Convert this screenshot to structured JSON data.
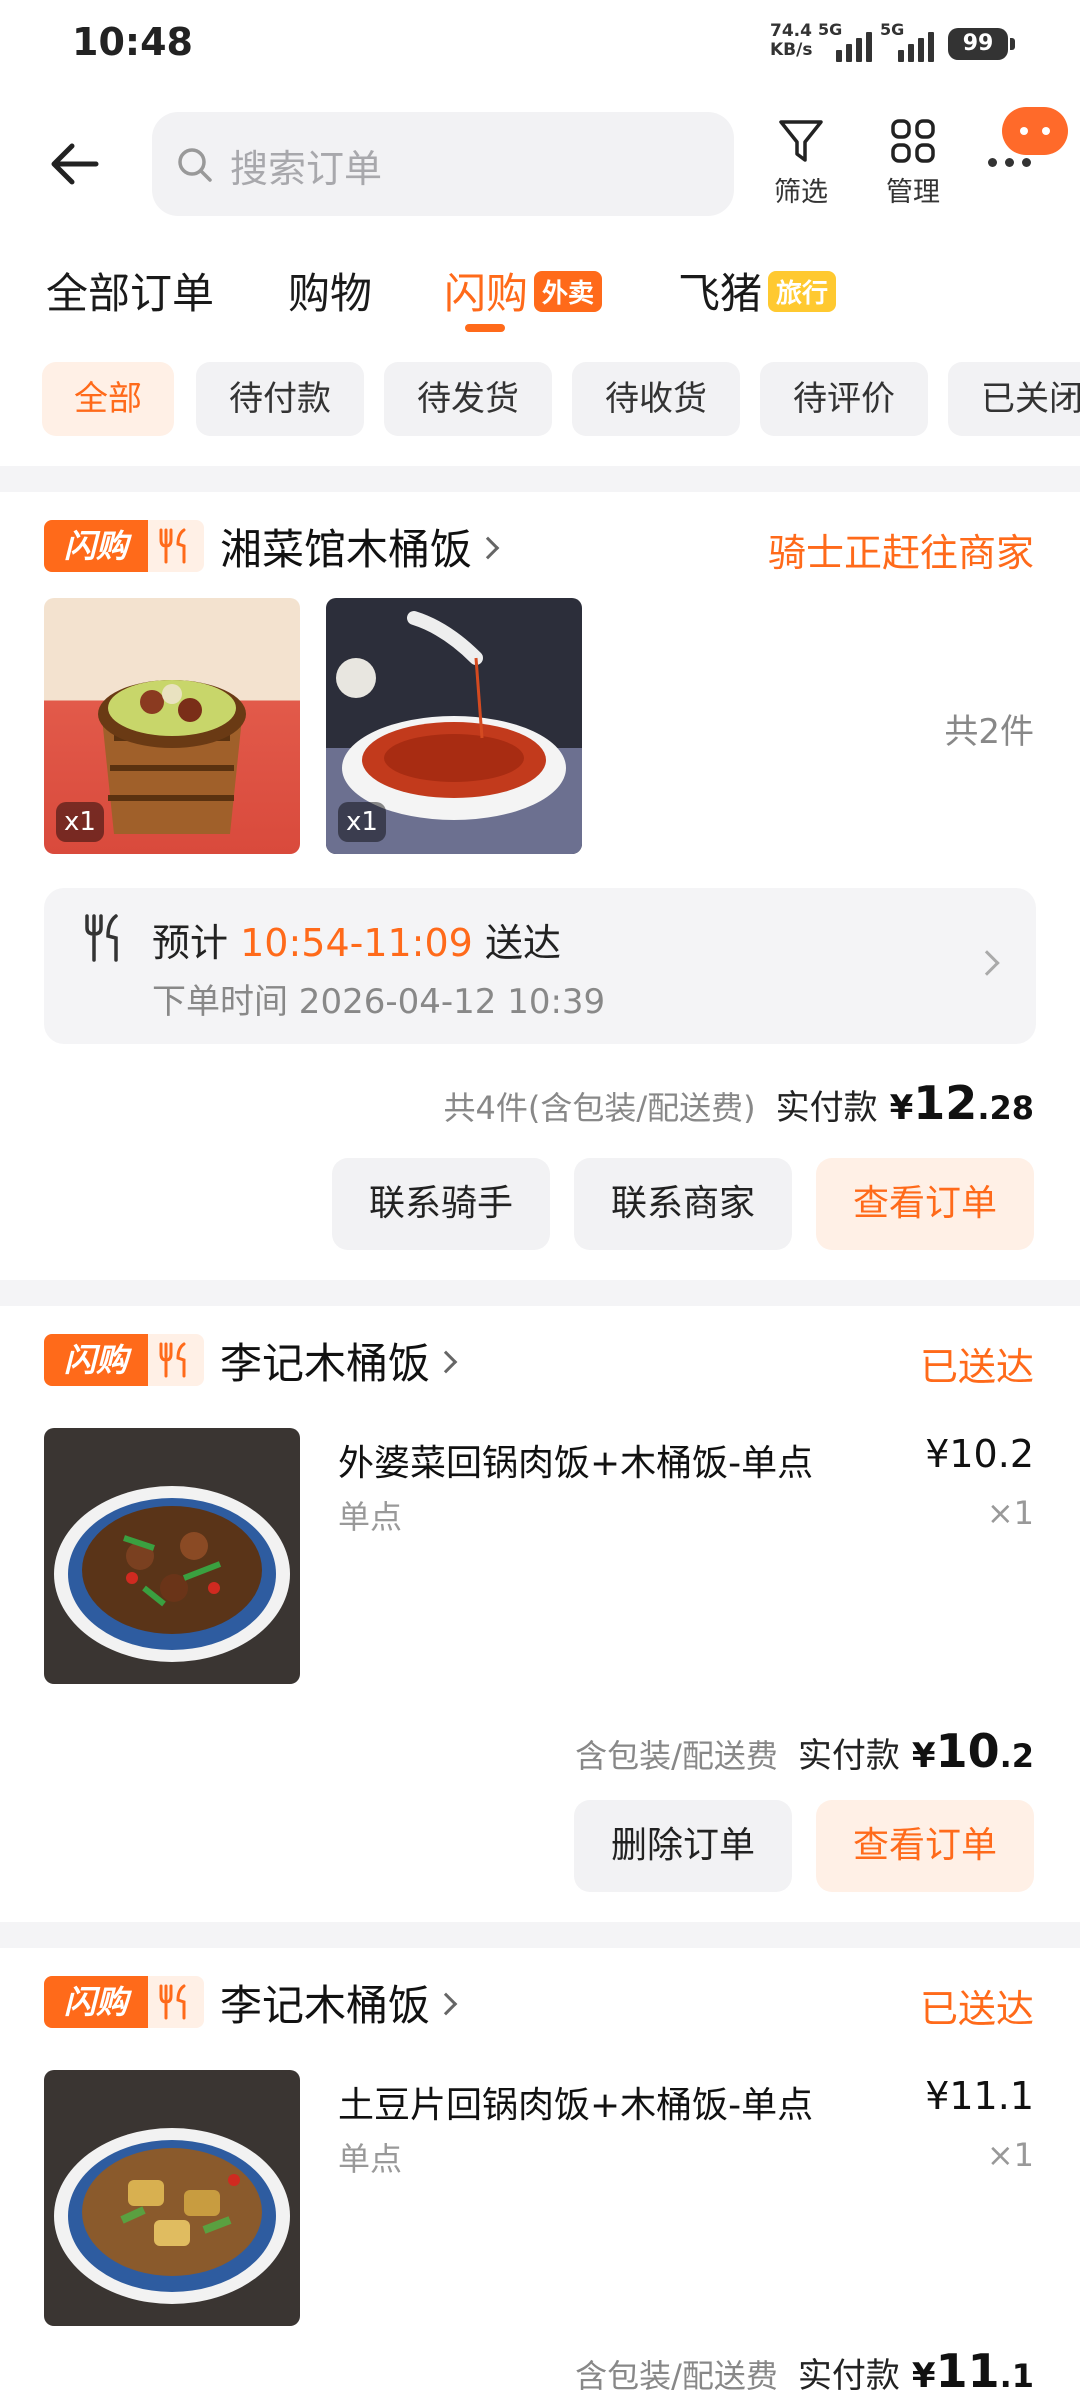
{
  "status_bar": {
    "time": "10:48",
    "speed": "74.4",
    "speed_unit": "KB/s",
    "net1": "5G",
    "net2": "5G",
    "battery": "99"
  },
  "header": {
    "search_placeholder": "搜索订单",
    "filter_label": "筛选",
    "manage_label": "管理"
  },
  "tabs": [
    {
      "label": "全部订单"
    },
    {
      "label": "购物"
    },
    {
      "label": "闪购",
      "tag": "外卖"
    },
    {
      "label": "飞猪",
      "tag": "旅行"
    }
  ],
  "chips": [
    "全部",
    "待付款",
    "待发货",
    "待收货",
    "待评价",
    "已关闭"
  ],
  "colors": {
    "accent": "#ff6a1a",
    "accent_light": "#fff0e6",
    "travel_tag": "#ffc930"
  },
  "orders": [
    {
      "badge": "闪购",
      "shop": "湘菜馆木桶饭",
      "status": "骑士正赶往商家",
      "item_qty_badges": [
        "x1",
        "x1"
      ],
      "item_count": "共2件",
      "eta_prefix": "预计",
      "eta_time": "10:54-11:09",
      "eta_suffix": "送达",
      "order_time": "下单时间 2026-04-12 10:39",
      "pay_note": "共4件(含包装/配送费)",
      "pay_label": "实付款",
      "currency": "¥",
      "pay_int": "12",
      "pay_dec": ".28",
      "buttons": [
        "联系骑手",
        "联系商家",
        "查看订单"
      ]
    },
    {
      "badge": "闪购",
      "shop": "李记木桶饭",
      "status": "已送达",
      "item_name": "外婆菜回锅肉饭+木桶饭-单点",
      "item_price": "¥10.2",
      "item_spec": "单点",
      "item_qty": "×1",
      "pay_note": "含包装/配送费",
      "pay_label": "实付款",
      "currency": "¥",
      "pay_int": "10",
      "pay_dec": ".2",
      "buttons": [
        "删除订单",
        "查看订单"
      ]
    },
    {
      "badge": "闪购",
      "shop": "李记木桶饭",
      "status": "已送达",
      "item_name": "土豆片回锅肉饭+木桶饭-单点",
      "item_price": "¥11.1",
      "item_spec": "单点",
      "item_qty": "×1",
      "pay_note": "含包装/配送费",
      "pay_label": "实付款",
      "currency": "¥",
      "pay_int": "11",
      "pay_dec": ".1"
    }
  ]
}
